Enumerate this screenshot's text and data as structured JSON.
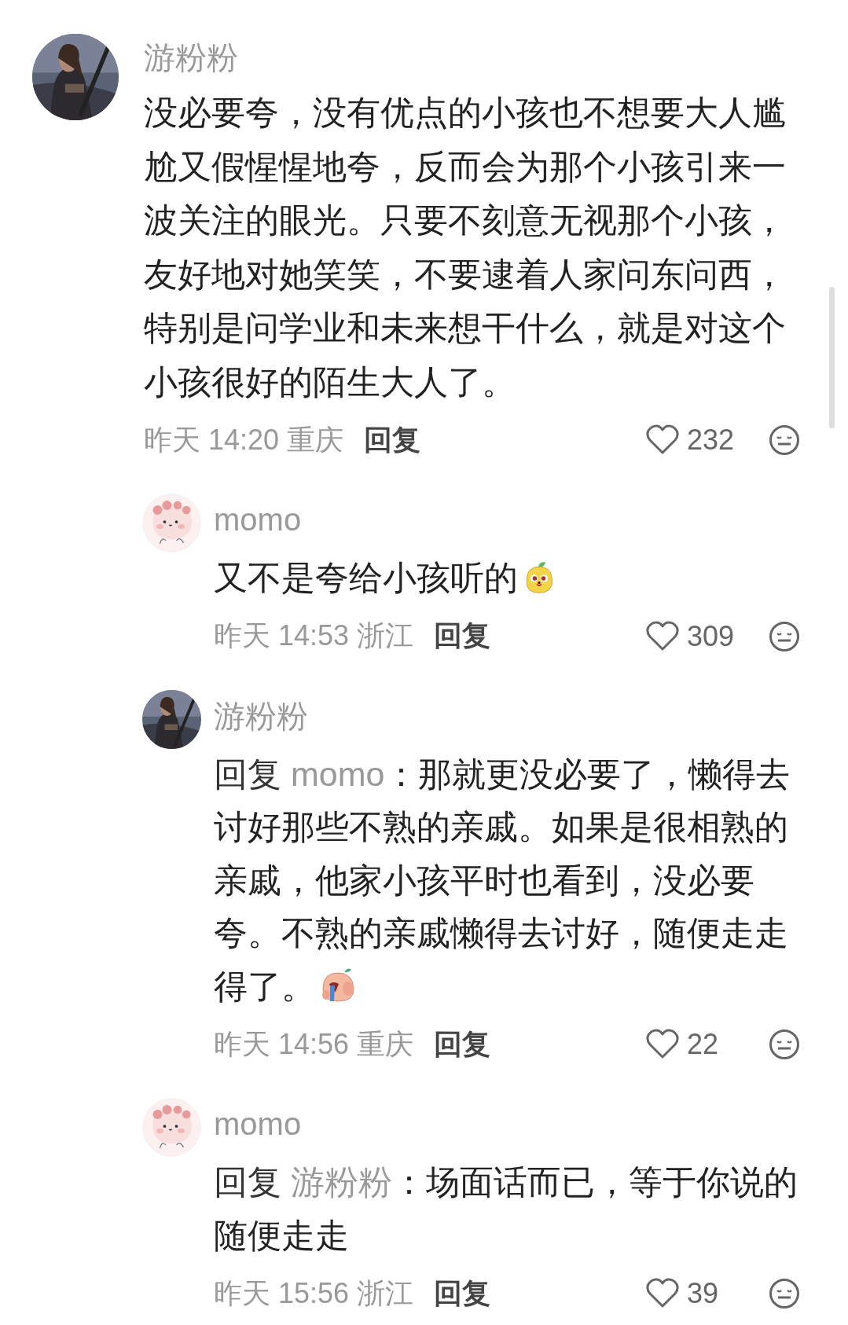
{
  "comments": [
    {
      "kind": "top",
      "author": "游粉粉",
      "text": "没必要夸，没有优点的小孩也不想要大人尴尬又假惺惺地夸，反而会为那个小孩引来一波关注的眼光。只要不刻意无视那个小孩，友好地对她笑笑，不要逮着人家问东问西，特别是问学业和未来想干什么，就是对这个小孩很好的陌生大人了。",
      "time": "昨天 14:20",
      "location": "重庆",
      "reply_label": "回复",
      "likes": "232"
    },
    {
      "kind": "reply",
      "avatar": {
        "kind": "cartoon"
      },
      "author": "momo",
      "text": "又不是夸给小孩听的",
      "sticker": {
        "kind": "fruit"
      },
      "time": "昨天 14:53",
      "location": "浙江",
      "reply_label": "回复",
      "likes": "309"
    },
    {
      "kind": "reply",
      "author": "游粉粉",
      "reply_prefix": "回复",
      "reply_to": "momo",
      "text": "：那就更没必要了，懒得去讨好那些不熟的亲戚。如果是很相熟的亲戚，他家小孩平时也看到，没必要夸。不熟的亲戚懒得去讨好，随便走走得了。",
      "sticker": {
        "kind": "crying"
      },
      "time": "昨天 14:56",
      "location": "重庆",
      "reply_label": "回复",
      "likes": "22"
    },
    {
      "kind": "reply",
      "avatar": {
        "kind": "cartoon"
      },
      "author": "momo",
      "reply_prefix": "回复",
      "reply_to": "游粉粉",
      "text": "：场面话而已，等于你说的随便走走",
      "time": "昨天 15:56",
      "location": "浙江",
      "reply_label": "回复",
      "likes": "39"
    }
  ]
}
